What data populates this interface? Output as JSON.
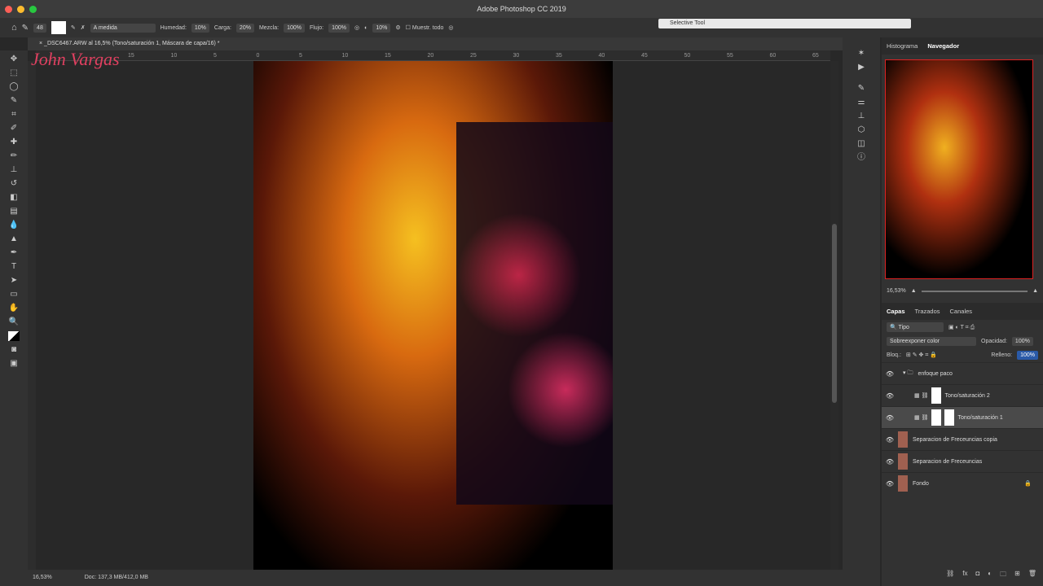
{
  "app": {
    "title": "Adobe Photoshop CC 2019"
  },
  "options": {
    "brush_size": "48",
    "mode": "A medida",
    "humedad_label": "Humedad:",
    "humedad": "10%",
    "carga_label": "Carga:",
    "carga": "20%",
    "mezcla_label": "Mezcla:",
    "mezcla": "100%",
    "flujo_label": "Flujo:",
    "flujo": "100%",
    "angle": "10%",
    "muestr": "Muestr. todo"
  },
  "selective_tool": "Selective Tool",
  "document": {
    "tab": "_DSC6467.ARW al 16,5% (Tono/saturación 1, Máscara de capa/16) *",
    "watermark": "John Vargas",
    "zoom": "16,53%",
    "doc_size": "Doc: 137,3 MB/412,0 MB"
  },
  "ruler": [
    "15",
    "10",
    "5",
    "0",
    "5",
    "10",
    "15",
    "20",
    "25",
    "30",
    "35",
    "40",
    "45",
    "50",
    "55",
    "60",
    "65"
  ],
  "navigator": {
    "tabs": [
      "Histograma",
      "Navegador"
    ],
    "zoom": "16,53%"
  },
  "layers_panel": {
    "tabs": [
      "Capas",
      "Trazados",
      "Canales"
    ],
    "filter": "Tipo",
    "blend_mode": "Sobreexponer color",
    "opacity_label": "Opacidad:",
    "opacity": "100%",
    "lock_label": "Bloq.:",
    "fill_label": "Relleno:",
    "fill": "100%",
    "layers": [
      {
        "name": "enfoque paco",
        "type": "group"
      },
      {
        "name": "Tono/saturación 2",
        "type": "adjustment"
      },
      {
        "name": "Tono/saturación 1",
        "type": "adjustment",
        "selected": true
      },
      {
        "name": "Separacion de Freceuncias copia",
        "type": "pixel"
      },
      {
        "name": "Separacion de Freceuncias",
        "type": "pixel"
      },
      {
        "name": "Fondo",
        "type": "pixel",
        "locked": true
      }
    ]
  }
}
